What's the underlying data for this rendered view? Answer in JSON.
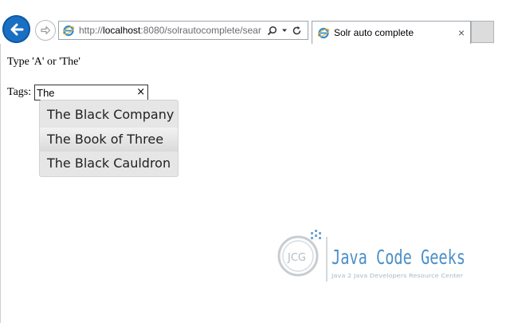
{
  "browser": {
    "url_prefix": "http://",
    "url_host": "localhost",
    "url_rest": ":8080/solrautocomplete/sear",
    "tab_title": "Solr auto complete",
    "tab_close": "×"
  },
  "page": {
    "instruction": "Type 'A' or 'The'",
    "tags_label": "Tags:",
    "tags_value": "The",
    "clear_button": "×"
  },
  "autocomplete": {
    "items": [
      {
        "label": "The Black Company"
      },
      {
        "label": "The Book of Three"
      },
      {
        "label": "The Black Cauldron"
      }
    ],
    "highlighted_index": 1
  },
  "watermark": {
    "monogram": "JCG",
    "name": "Java Code Geeks",
    "tagline": "Java 2 Java Developers Resource Center"
  },
  "colors": {
    "back_button": "#1a6fc2",
    "watermark_text": "#4a8fc8"
  },
  "icons": [
    "back-arrow-icon",
    "forward-arrow-icon",
    "ie-logo-icon",
    "search-icon",
    "dropdown-icon",
    "refresh-icon",
    "close-icon"
  ]
}
